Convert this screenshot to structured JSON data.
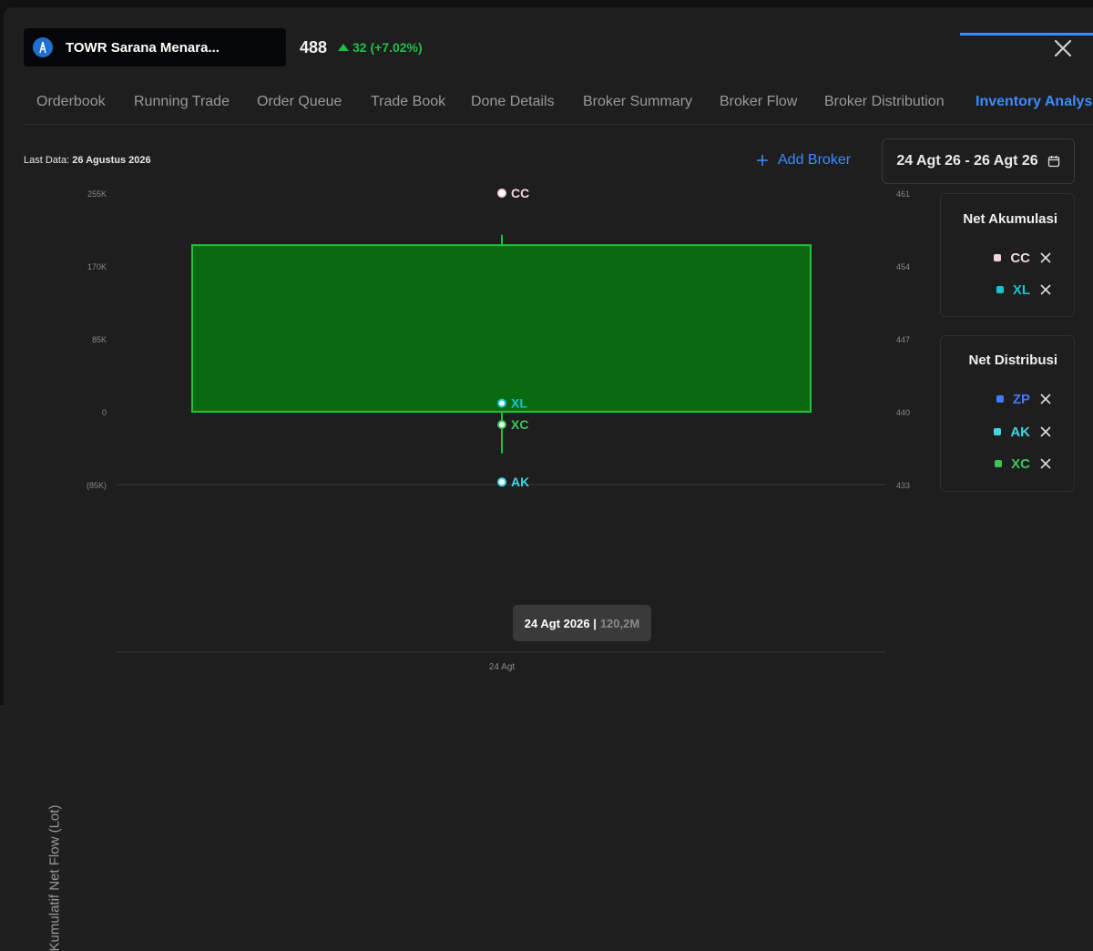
{
  "header": {
    "ticker_name": "TOWR Sarana Menara...",
    "price": "488",
    "change": "32 (+7.02%)",
    "up_color": "#1fbf4a"
  },
  "tabs": [
    {
      "label": "Orderbook"
    },
    {
      "label": "Running Trade"
    },
    {
      "label": "Order Queue"
    },
    {
      "label": "Trade Book"
    },
    {
      "label": "Done Details"
    },
    {
      "label": "Broker Summary"
    },
    {
      "label": "Broker Flow"
    },
    {
      "label": "Broker Distribution"
    },
    {
      "label": "Inventory Analysis",
      "active": true
    }
  ],
  "toolbar": {
    "last_data_label": "Last Data:",
    "last_data_value": "26 Agustus 2026",
    "add_broker_label": "Add Broker",
    "date_range": "24 Agt 26 - 26 Agt 26"
  },
  "net_akumulasi": {
    "title": "Net Akumulasi",
    "items": [
      {
        "code": "CC",
        "color": "#f5d5dc"
      },
      {
        "code": "XL",
        "color": "#15c4cf"
      }
    ]
  },
  "net_distribusi": {
    "title": "Net Distribusi",
    "items": [
      {
        "code": "ZP",
        "color": "#3d7bff"
      },
      {
        "code": "AK",
        "color": "#3fd6e6"
      },
      {
        "code": "XC",
        "color": "#3ec45a"
      }
    ]
  },
  "tooltip": {
    "date": "24 Agt 2026 |",
    "value": "120,2M"
  },
  "chart_data": {
    "type": "candlestick",
    "ylabel": "Kumulatif Net Flow (Lot)",
    "y_left_ticks": [
      "255K",
      "170K",
      "85K",
      "0",
      "(85K)"
    ],
    "y_left_values": [
      255000,
      170000,
      85000,
      0,
      -85000
    ],
    "y_right_ticks": [
      "461",
      "454",
      "447",
      "440",
      "433"
    ],
    "y_right_values": [
      461,
      454,
      447,
      440,
      433
    ],
    "x_ticks": [
      "24 Agt"
    ],
    "candle": {
      "open": 440,
      "close": 456,
      "high": 457,
      "low": 436,
      "color": "#0a6a10",
      "border": "#1ec43a"
    },
    "broker_points": [
      {
        "code": "CC",
        "value": 255000,
        "color": "#f5d5dc"
      },
      {
        "code": "XL",
        "value": 10000,
        "color": "#15c4cf"
      },
      {
        "code": "XC",
        "value": -15000,
        "color": "#3ec45a"
      },
      {
        "code": "AK",
        "value": -82000,
        "color": "#3fd6e6"
      }
    ],
    "grid": true
  }
}
